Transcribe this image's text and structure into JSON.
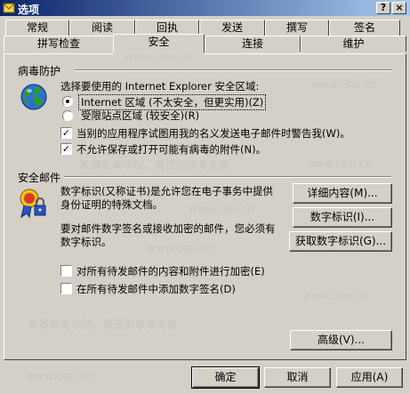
{
  "title": "选项",
  "title_buttons": {
    "help": "?",
    "close": "×"
  },
  "tabs_row1": [
    "常规",
    "阅读",
    "回执",
    "发送",
    "撰写",
    "签名"
  ],
  "tabs_row2": [
    "拼写检查",
    "安全",
    "连接",
    "维护"
  ],
  "active_tab": "安全",
  "virus": {
    "heading": "病毒防护",
    "zone_prompt": "选择要使用的 Internet Explorer 安全区域:",
    "radio_internet": "Internet 区域 (不太安全，但更实用)(Z)",
    "radio_restricted": "受限站点区域 (较安全)(R)",
    "check_warn": "当别的应用程序试图用我的名义发送电子邮件时警告我(W)。",
    "check_block": "不允许保存或打开可能有病毒的附件(N)。"
  },
  "secure_mail": {
    "heading": "安全邮件",
    "desc1": "数字标识(又称证书)是允许您在电子事务中提供\n身份证明的特殊文档。",
    "desc2": "要对邮件数字签名或接收加密的邮件，您必须有\n数字标识。",
    "btn_details": "详细内容(M)...",
    "btn_digital_id": "数字标识(I)...",
    "btn_get_id": "获取数字标识(G)...",
    "check_encrypt": "对所有待发邮件的内容和附件进行加密(E)",
    "check_sign": "在所有待发邮件中添加数字签名(D)"
  },
  "btn_advanced": "高级(V)...",
  "footer": {
    "ok": "确定",
    "cancel": "取消",
    "apply": "应用(A)"
  },
  "watermarks": [
    "www.csai.cn",
    "希赛软考学院，真正的软考专家"
  ]
}
